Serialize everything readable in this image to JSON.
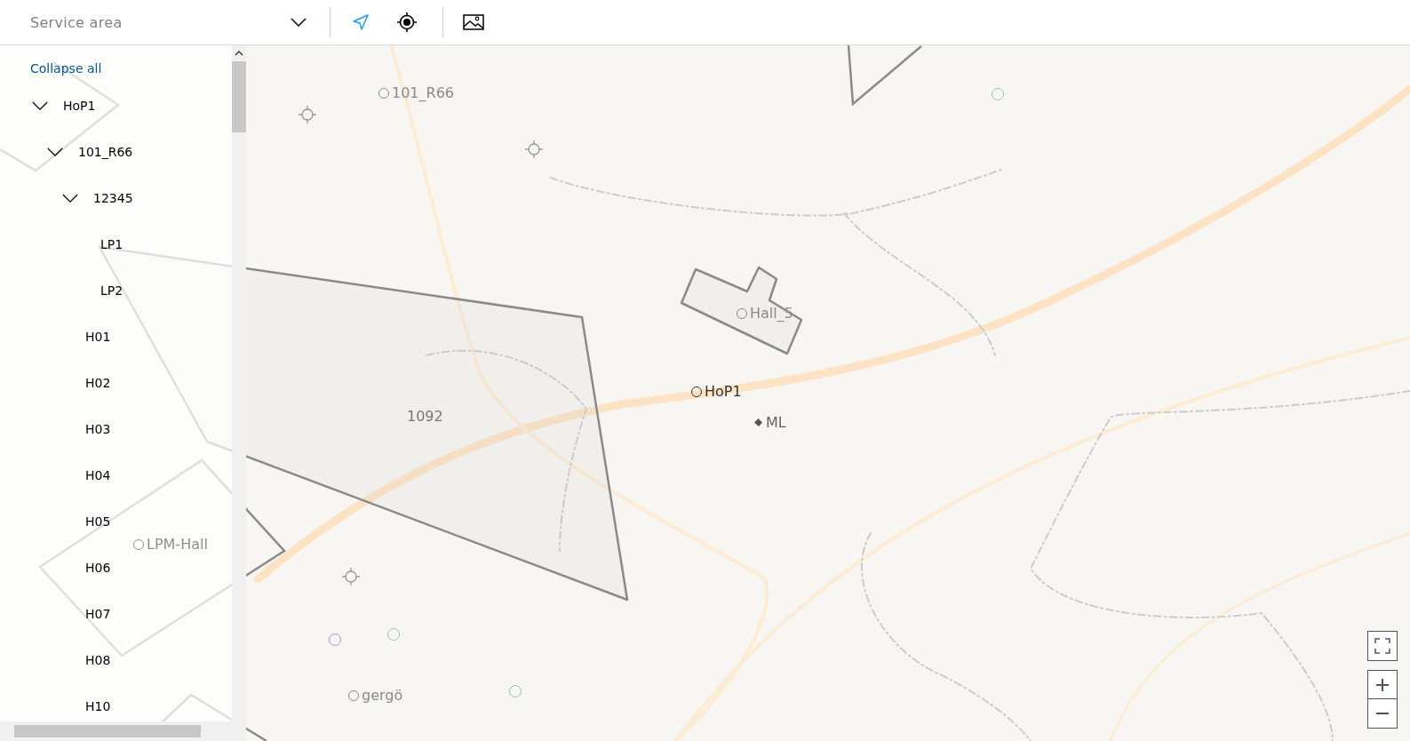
{
  "toolbar": {
    "service_area": {
      "placeholder": "Service area"
    },
    "tools": [
      {
        "kind": "navigate",
        "selected": true
      },
      {
        "kind": "locate",
        "selected": false
      },
      {
        "kind": "image",
        "selected": false
      }
    ]
  },
  "tree": {
    "collapse_all": "Collapse all",
    "items": [
      {
        "label": "HoP1",
        "expanded": true,
        "children": [
          {
            "label": "101_R66",
            "expanded": true,
            "children": [
              {
                "label": "12345",
                "expanded": true,
                "children": [
                  {
                    "label": "LP1"
                  },
                  {
                    "label": "LP2"
                  }
                ]
              },
              {
                "label": "H01"
              },
              {
                "label": "H02"
              },
              {
                "label": "H03"
              },
              {
                "label": "H04"
              },
              {
                "label": "H05"
              },
              {
                "label": "H06"
              },
              {
                "label": "H07"
              },
              {
                "label": "H08"
              },
              {
                "label": "H10"
              }
            ]
          }
        ]
      }
    ]
  },
  "map": {
    "markers": [
      {
        "label": "101_R66",
        "kind": "place"
      },
      {
        "label": "Hall_5",
        "kind": "place"
      },
      {
        "label": "HoP1",
        "kind": "hub"
      },
      {
        "label": "ML",
        "kind": "machine"
      },
      {
        "label": "1092",
        "kind": "area"
      },
      {
        "label": "gergö",
        "kind": "place"
      },
      {
        "label": "LPM-Hall",
        "kind": "faint"
      }
    ]
  }
}
